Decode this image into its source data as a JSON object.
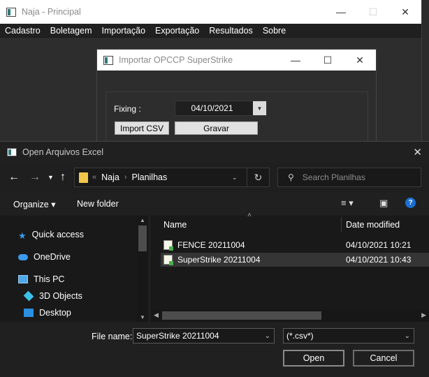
{
  "main_window": {
    "title": "Naja - Principal",
    "menu": [
      "Cadastro",
      "Boletagem",
      "Importação",
      "Exportação",
      "Resultados",
      "Sobre"
    ]
  },
  "import_dialog": {
    "title": "Importar OPCCP SuperStrike",
    "fixing_label": "Fixing :",
    "fixing_date": "04/10/2021",
    "import_csv_label": "Import CSV",
    "save_label": "Gravar"
  },
  "file_dialog": {
    "title": "Open Arquivos Excel",
    "breadcrumb": [
      "Naja",
      "Planilhas"
    ],
    "breadcrumb_overflow": "«",
    "search_placeholder": "Search Planilhas",
    "toolbar": {
      "organize_label": "Organize",
      "new_folder_label": "New folder"
    },
    "nav_items": [
      {
        "label": "Quick access",
        "icon": "star-icon"
      },
      {
        "label": "OneDrive",
        "icon": "cloud-icon"
      },
      {
        "label": "This PC",
        "icon": "computer-icon"
      },
      {
        "label": "3D Objects",
        "icon": "cube-icon"
      },
      {
        "label": "Desktop",
        "icon": "desktop-icon"
      }
    ],
    "columns": {
      "name": "Name",
      "date_modified": "Date modified"
    },
    "files": [
      {
        "name": "FENCE 20211004",
        "date": "04/10/2021 10:21",
        "selected": false
      },
      {
        "name": "SuperStrike 20211004",
        "date": "04/10/2021 10:43",
        "selected": true
      }
    ],
    "file_name_label": "File name:",
    "file_name_value": "SuperStrike 20211004",
    "file_type_value": "(*.csv*)",
    "open_label": "Open",
    "cancel_label": "Cancel"
  },
  "colors": {
    "accent_orange": "#e08a1e",
    "folder_yellow": "#f3c84a",
    "help_blue": "#1a6fd0"
  }
}
